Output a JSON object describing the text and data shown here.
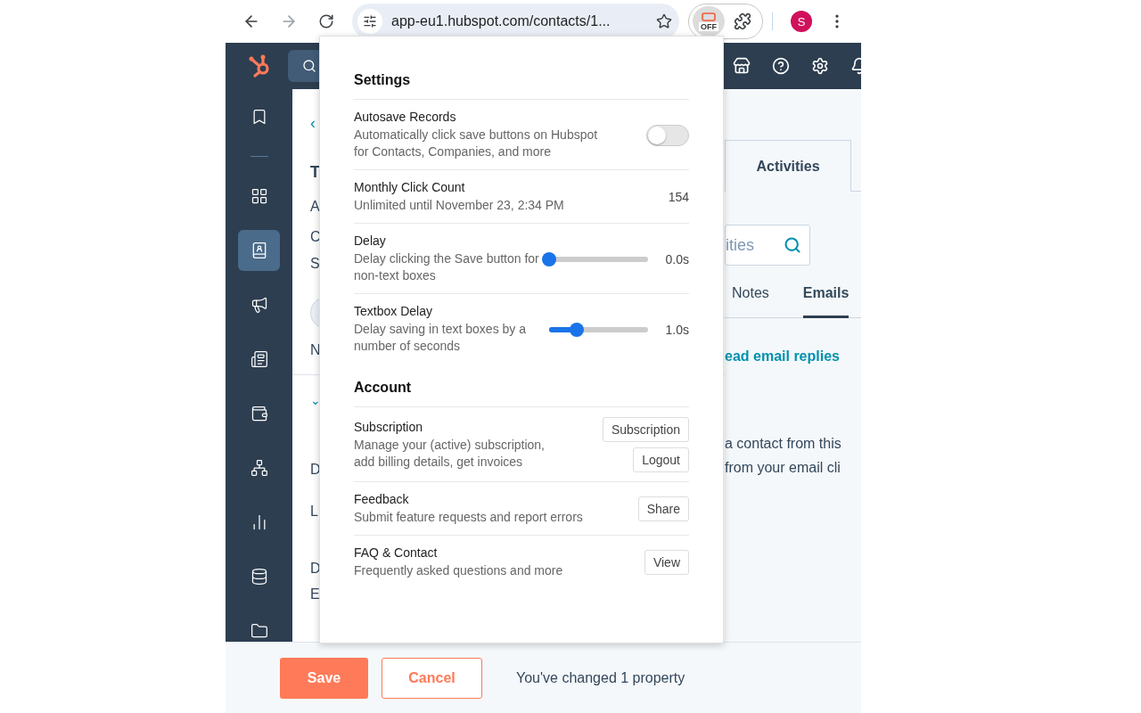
{
  "browser": {
    "url": "app-eu1.hubspot.com/contacts/1...",
    "extension_badge": "OFF",
    "profile_initial": "S"
  },
  "sidebar": {
    "items": [
      {
        "kind": "bookmark",
        "selected": false
      },
      {
        "kind": "grid",
        "selected": false
      },
      {
        "kind": "contacts",
        "selected": true
      },
      {
        "kind": "megaphone",
        "selected": false
      },
      {
        "kind": "document",
        "selected": false
      },
      {
        "kind": "wallet",
        "selected": false
      },
      {
        "kind": "network",
        "selected": false
      },
      {
        "kind": "chart",
        "selected": false
      },
      {
        "kind": "database",
        "selected": false
      },
      {
        "kind": "folder",
        "selected": false
      }
    ]
  },
  "record": {
    "back": "‹",
    "chevron": "⌄",
    "fragments": [
      "T",
      "A",
      "C",
      "S",
      "N",
      "D",
      "L",
      "D",
      "E"
    ]
  },
  "right_panel": {
    "tabs": [
      {
        "label": "Activities",
        "selected": true
      }
    ],
    "search": {
      "placeholder": "ities"
    },
    "filter_tabs": [
      {
        "label": "Notes",
        "selected": false
      },
      {
        "label": "Emails",
        "selected": true
      }
    ],
    "link": "ead email replies",
    "message_lines": [
      "a contact from this",
      "from your email cli"
    ]
  },
  "popup": {
    "sections": [
      {
        "title": "Settings",
        "rows": [
          {
            "kind": "toggle",
            "label": "Autosave Records",
            "description": "Automatically click save buttons on Hubspot for Contacts, Companies, and more",
            "on": false
          },
          {
            "kind": "value",
            "label": "Monthly Click Count",
            "description": "Unlimited until November 23, 2:34 PM",
            "value": "154"
          },
          {
            "kind": "slider",
            "label": "Delay",
            "description": "Delay clicking the Save button for non-text boxes",
            "level": 0,
            "reading": "0.0s"
          },
          {
            "kind": "slider",
            "label": "Textbox Delay",
            "description": "Delay saving in text boxes by a number of seconds",
            "level": 0.28,
            "reading": "1.0s"
          }
        ]
      },
      {
        "title": "Account",
        "rows": [
          {
            "kind": "buttons",
            "label": "Subscription",
            "description": "Manage your (active) subscription, add billing details, get invoices",
            "buttons": [
              "Subscription",
              "Logout"
            ]
          },
          {
            "kind": "buttons",
            "label": "Feedback",
            "description": "Submit feature requests and report errors",
            "buttons": [
              "Share"
            ]
          },
          {
            "kind": "buttons",
            "label": "FAQ & Contact",
            "description": "Frequently asked questions and more",
            "buttons": [
              "View"
            ]
          }
        ]
      }
    ]
  },
  "footer": {
    "save": "Save",
    "cancel": "Cancel",
    "message": "You've changed 1 property"
  }
}
